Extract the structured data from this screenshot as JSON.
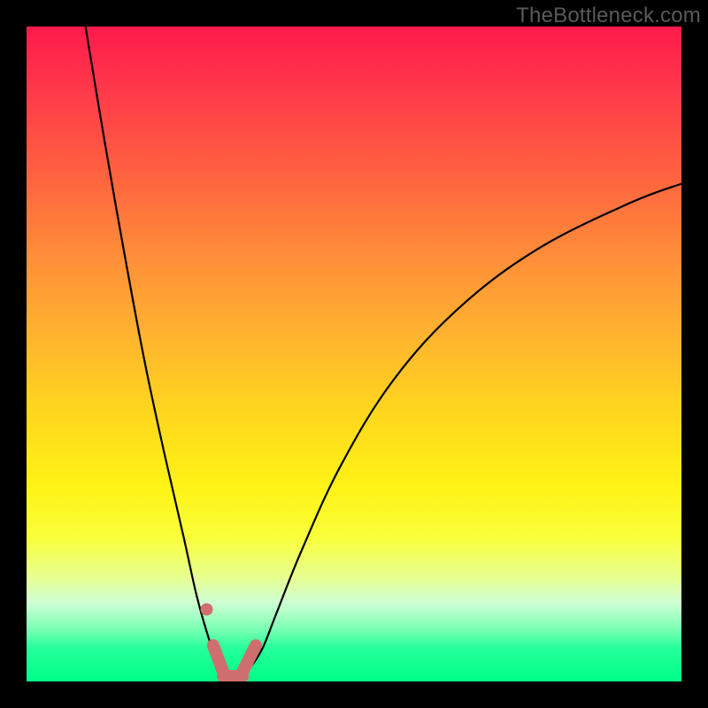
{
  "watermark": {
    "text": "TheBottleneck.com"
  },
  "colors": {
    "frame": "#000000",
    "curve_stroke": "#000000",
    "marker_fill": "#cf6e6e",
    "gradient_top": "#ff1a4b",
    "gradient_bottom": "#00ff88"
  },
  "chart_data": {
    "type": "line",
    "title": "",
    "xlabel": "",
    "ylabel": "",
    "xlim": [
      0,
      100
    ],
    "ylim": [
      0,
      100
    ],
    "grid": false,
    "series": [
      {
        "name": "bottleneck-curve",
        "x": [
          9,
          12,
          15,
          18,
          21,
          24,
          26,
          28,
          29.5,
          30.5,
          32,
          34,
          36,
          38,
          42,
          48,
          56,
          66,
          78,
          92,
          100
        ],
        "y": [
          100,
          82,
          65,
          49,
          35,
          22,
          13,
          6,
          2,
          0.5,
          0.5,
          2,
          5,
          10,
          20,
          33,
          46,
          57,
          66,
          73,
          76
        ]
      }
    ],
    "markers": [
      {
        "name": "dot-left",
        "x": 27.5,
        "y": 11
      },
      {
        "name": "seg-a",
        "kind": "segment",
        "x1": 28.5,
        "y1": 5.5,
        "x2": 30.0,
        "y2": 1.5
      },
      {
        "name": "seg-b",
        "kind": "segment",
        "x1": 30.0,
        "y1": 0.8,
        "x2": 33.0,
        "y2": 0.8
      },
      {
        "name": "seg-c",
        "kind": "segment",
        "x1": 33.0,
        "y1": 1.5,
        "x2": 35.0,
        "y2": 5.5
      }
    ],
    "marker_stroke_width": 14,
    "curve_stroke_width": 2.2
  }
}
